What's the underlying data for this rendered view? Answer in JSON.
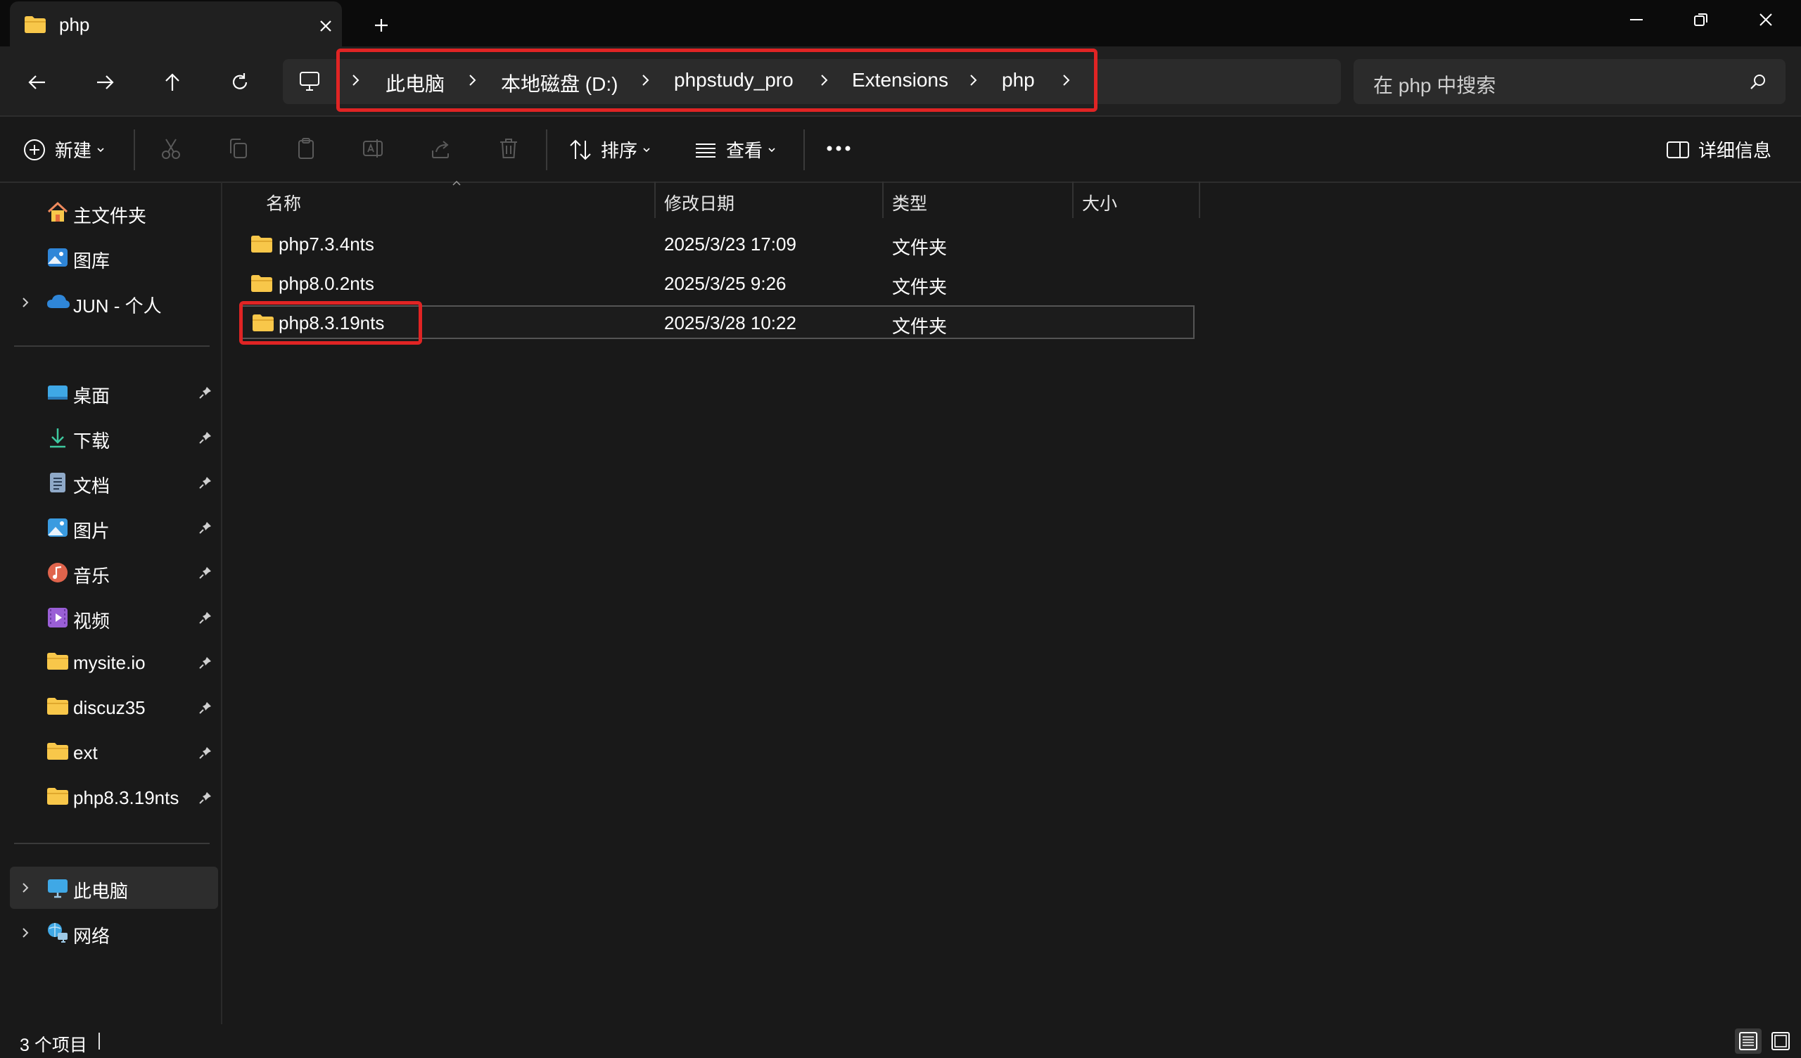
{
  "window": {
    "tab_title": "php"
  },
  "address": {
    "crumbs": [
      "此电脑",
      "本地磁盘 (D:)",
      "phpstudy_pro",
      "Extensions",
      "php"
    ]
  },
  "search": {
    "placeholder": "在 php 中搜索"
  },
  "commandbar": {
    "new_label": "新建",
    "sort_label": "排序",
    "view_label": "查看",
    "details_label": "详细信息"
  },
  "sidebar": {
    "top": [
      {
        "label": "主文件夹",
        "icon": "home-icon"
      },
      {
        "label": "图库",
        "icon": "gallery-icon"
      },
      {
        "label": "JUN - 个人",
        "icon": "onedrive-cloud-icon"
      }
    ],
    "pinned": [
      {
        "label": "桌面",
        "icon": "desktop-icon"
      },
      {
        "label": "下载",
        "icon": "download-icon"
      },
      {
        "label": "文档",
        "icon": "document-icon"
      },
      {
        "label": "图片",
        "icon": "pictures-icon"
      },
      {
        "label": "音乐",
        "icon": "music-icon"
      },
      {
        "label": "视频",
        "icon": "video-icon"
      },
      {
        "label": "mysite.io",
        "icon": "folder-icon"
      },
      {
        "label": "discuz35",
        "icon": "folder-icon"
      },
      {
        "label": "ext",
        "icon": "folder-icon"
      },
      {
        "label": "php8.3.19nts",
        "icon": "folder-icon"
      }
    ],
    "bottom": [
      {
        "label": "此电脑",
        "icon": "this-pc-icon"
      },
      {
        "label": "网络",
        "icon": "network-icon"
      }
    ]
  },
  "filelist": {
    "columns": [
      "名称",
      "修改日期",
      "类型",
      "大小"
    ],
    "rows": [
      {
        "name": "php7.3.4nts",
        "modified": "2025/3/23 17:09",
        "type": "文件夹",
        "size": ""
      },
      {
        "name": "php8.0.2nts",
        "modified": "2025/3/25 9:26",
        "type": "文件夹",
        "size": ""
      },
      {
        "name": "php8.3.19nts",
        "modified": "2025/3/28 10:22",
        "type": "文件夹",
        "size": ""
      }
    ],
    "selected_row": "php8.3.19nts"
  },
  "status": {
    "item_count": "3 个项目"
  },
  "colors": {
    "folder": "#f8c74a",
    "highlight": "#e02424",
    "background": "#191919"
  }
}
